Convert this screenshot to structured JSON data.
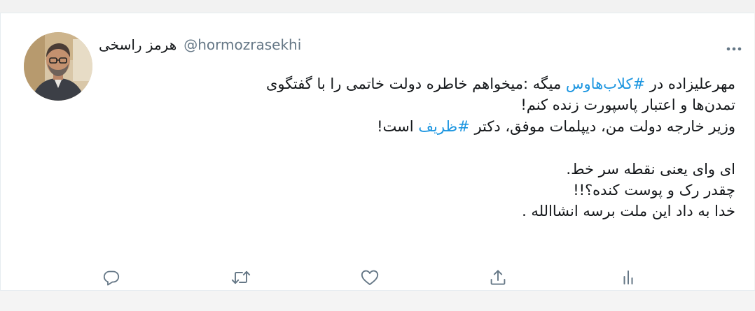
{
  "author": {
    "display_name": "هرمز راسخی",
    "handle": "@hormozrasekhi"
  },
  "tweet": {
    "line1_prefix": "مهرعلیزاده در ",
    "line1_hashtag": "#کلاب‌هاوس",
    "line1_suffix": " میگه :میخواهم خاطره دولت خاتمی را با گفتگوی",
    "line2": "تمدن‌ها و اعتبار پاسپورت زنده کنم!",
    "line3_prefix": "وزیر خارجه دولت من، دیپلمات موفق، دکتر ",
    "line3_hashtag": "#ظریف",
    "line3_suffix": " است!",
    "line4": "ای وای یعنی نقطه سر خط.",
    "line5": "چقدر رک و پوست کنده؟!!",
    "line6": "خدا به داد این ملت برسه انشاالله ."
  },
  "colors": {
    "text": "#14171a",
    "secondary": "#657786",
    "hashtag": "#1b95e0",
    "icon": "#657786"
  },
  "icons": {
    "more": "more-dots-icon",
    "reply": "reply-icon",
    "retweet": "retweet-icon",
    "like": "heart-icon",
    "share": "share-icon",
    "analytics": "analytics-icon"
  }
}
